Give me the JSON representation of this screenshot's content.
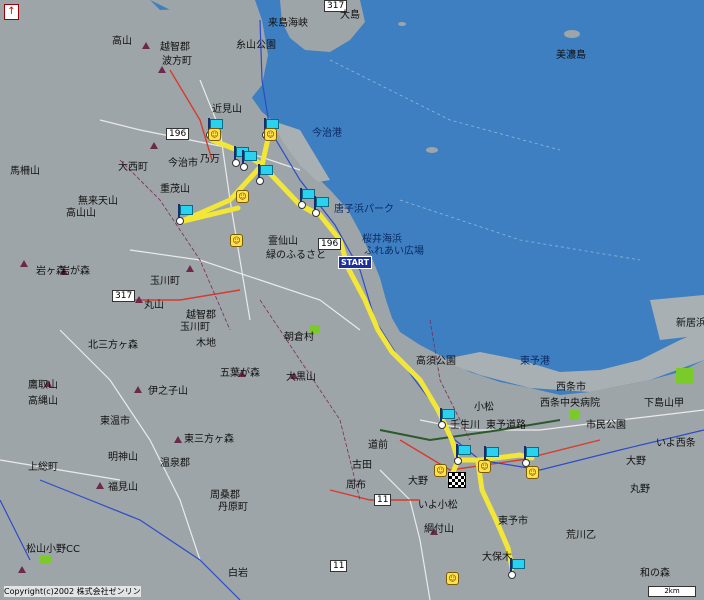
{
  "compass_symbol": "↑",
  "copyright": "Copyright(c)2002 株式会社ゼンリン",
  "scale_label": "2km",
  "start_label": "START",
  "route_color": "#f2e636",
  "sea_color": "#3d7fc0",
  "land_color": "#9ea5a8",
  "labels": {
    "l01": "糸山公園",
    "l02": "来島海峡",
    "l03": "317",
    "l04": "大島",
    "l05": "高山",
    "l06": "越智郡",
    "l07": "波方町",
    "l08": "近見山",
    "l09": "今治港",
    "l10": "196",
    "l11": "大西町",
    "l12": "今治市",
    "l13": "乃万",
    "l14": "重茂山",
    "l15": "無来天山",
    "l16": "高山山",
    "l17": "唐子浜パーク",
    "l18": "桜井海浜",
    "l19": "ふれあい広場",
    "l20": "霊仙山",
    "l21": "緑のふるさと",
    "l22": "196",
    "l23": "岩が森",
    "l24": "玉川町",
    "l25": "317",
    "l26": "丸山",
    "l27": "越智郡",
    "l28": "玉川町",
    "l29": "朝倉村",
    "l30": "北三方ヶ森",
    "l31": "木地",
    "l32": "五葉が森",
    "l33": "大黒山",
    "l34": "伊之子山",
    "l35": "東予港",
    "l36": "高須公園",
    "l37": "小松",
    "l38": "東予道路",
    "l39": "西条市",
    "l40": "市民公園",
    "l41": "下島山甲",
    "l42": "いよ西条",
    "l43": "大野",
    "l44": "東三方ヶ森",
    "l45": "明神山",
    "l46": "温泉郡",
    "l47": "福見山",
    "l48": "周桑郡",
    "l49": "丹原町",
    "l50": "古田",
    "l51": "11",
    "l52": "いよ小松",
    "l53": "綱付山",
    "l54": "東予市",
    "l55": "大保木",
    "l56": "松山小野CC",
    "l57": "11",
    "l58": "和の森",
    "l59": "美濃島",
    "l60": "新居浜",
    "l61": "鷹取山",
    "l62": "上総町",
    "l63": "馬柵山",
    "l64": "岩ヶ森",
    "l65": "高縄山",
    "l66": "西条中央病院",
    "l67": "丸野",
    "l68": "荒川乙",
    "l69": "白岩",
    "l70": "東温市",
    "l71": "壬生川",
    "l72": "道前",
    "l73": "周布",
    "l74": "大野"
  }
}
